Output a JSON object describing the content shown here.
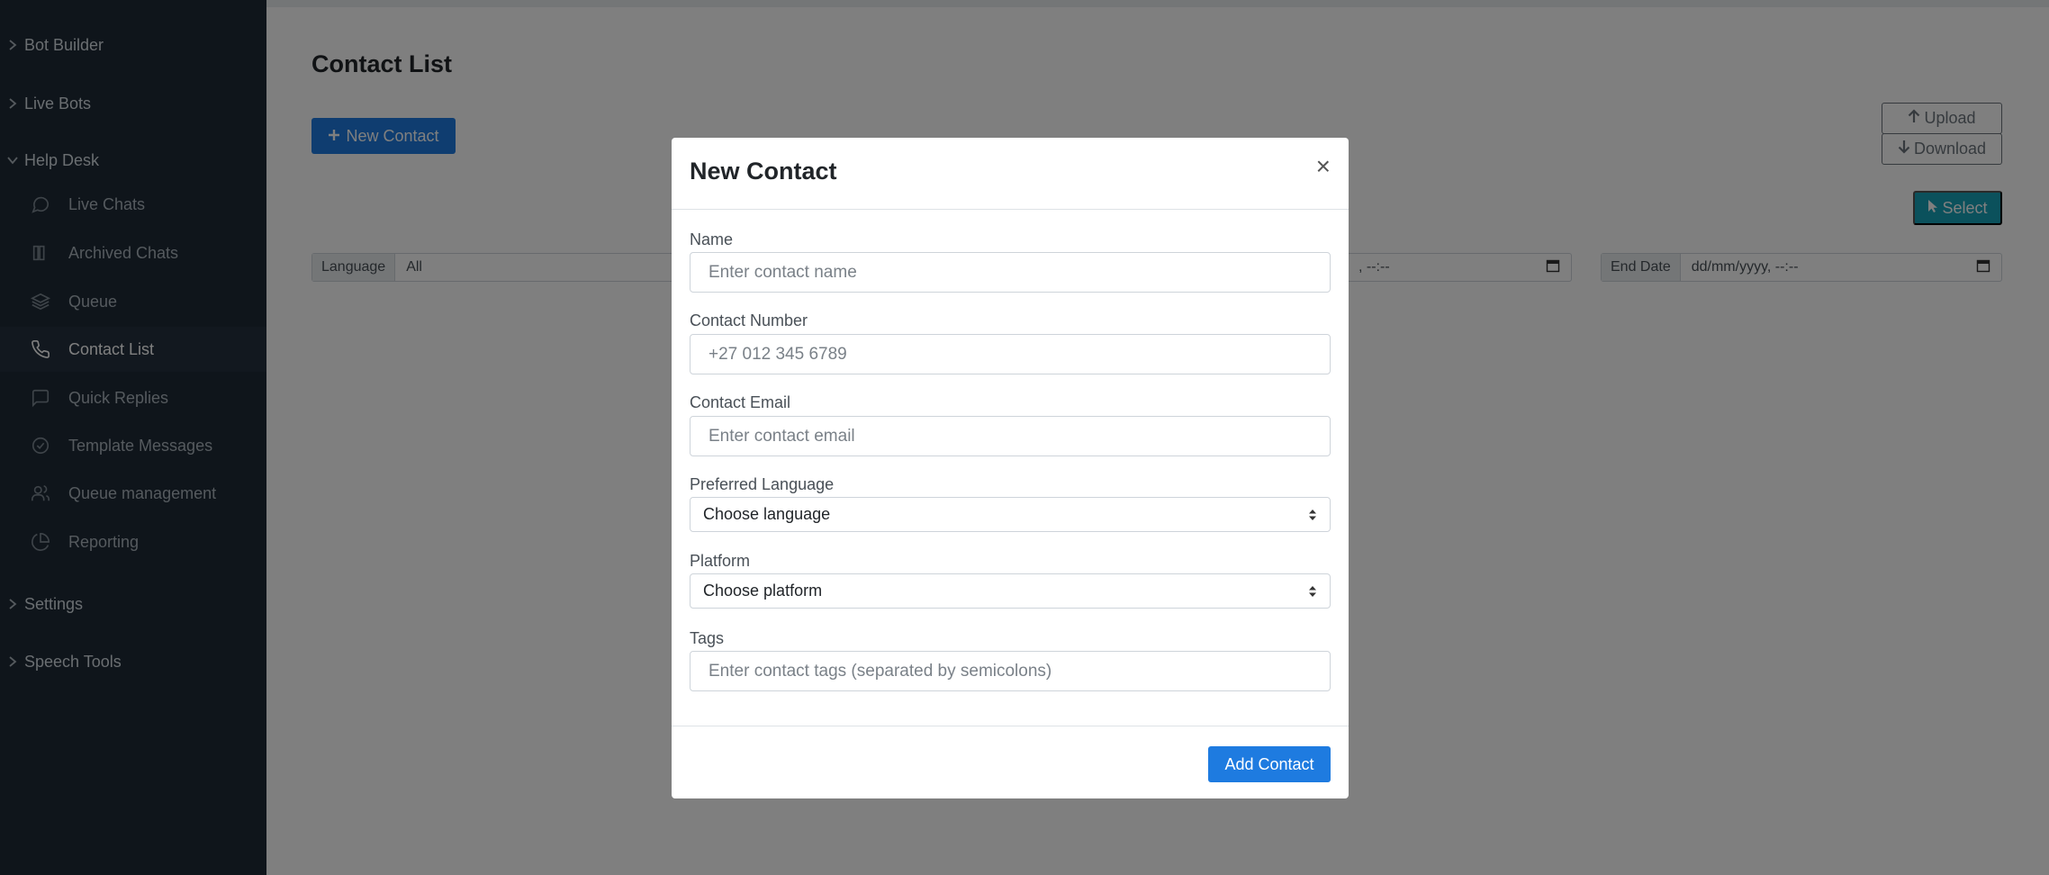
{
  "sidebar": {
    "groups": [
      {
        "label": "Bot Builder",
        "chevron": "chevron-right-icon"
      },
      {
        "label": "Live Bots",
        "chevron": "chevron-right-icon"
      },
      {
        "label": "Help Desk",
        "chevron": "chevron-down-icon"
      },
      {
        "label": "Settings",
        "chevron": "chevron-right-icon"
      },
      {
        "label": "Speech Tools",
        "chevron": "chevron-right-icon"
      }
    ],
    "items": [
      {
        "label": "Live Chats",
        "icon": "chat-bubble-icon"
      },
      {
        "label": "Archived Chats",
        "icon": "archive-icon"
      },
      {
        "label": "Queue",
        "icon": "layers-icon"
      },
      {
        "label": "Contact List",
        "icon": "phone-icon",
        "active": true
      },
      {
        "label": "Quick Replies",
        "icon": "message-square-icon"
      },
      {
        "label": "Template Messages",
        "icon": "check-circle-icon"
      },
      {
        "label": "Queue management",
        "icon": "users-icon"
      },
      {
        "label": "Reporting",
        "icon": "pie-chart-icon"
      }
    ]
  },
  "main": {
    "title": "Contact List",
    "new_contact_label": "New Contact",
    "upload_label": "Upload",
    "download_label": "Download",
    "select_label": "Select",
    "filters": {
      "language_label": "Language",
      "language_value": "All",
      "start_date_value": ", --:--",
      "end_date_label": "End Date",
      "end_date_value": "dd/mm/yyyy, --:--"
    }
  },
  "modal": {
    "title": "New Contact",
    "close_label": "×",
    "fields": {
      "name_label": "Name",
      "name_placeholder": "Enter contact name",
      "number_label": "Contact Number",
      "number_placeholder": "+27 012 345 6789",
      "email_label": "Contact Email",
      "email_placeholder": "Enter contact email",
      "language_label": "Preferred Language",
      "language_value": "Choose language",
      "platform_label": "Platform",
      "platform_value": "Choose platform",
      "tags_label": "Tags",
      "tags_placeholder": "Enter contact tags (separated by semicolons)"
    },
    "add_label": "Add Contact"
  },
  "colors": {
    "sidebar_bg": "#1e2a36",
    "primary": "#1e7be0",
    "info": "#17a2b8"
  }
}
